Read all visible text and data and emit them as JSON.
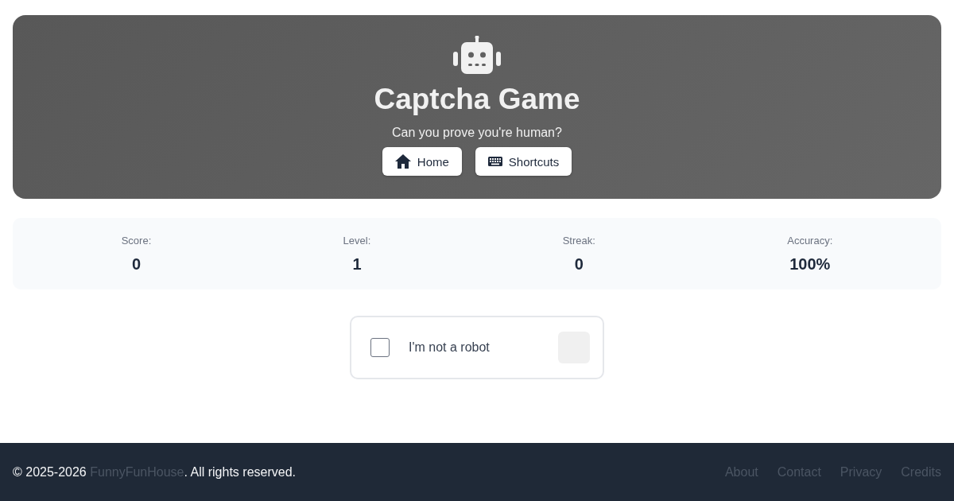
{
  "header": {
    "title": "Captcha Game",
    "subtitle": "Can you prove you're human?",
    "buttons": [
      {
        "kind": "home",
        "label": "Home"
      },
      {
        "kind": "keyboard",
        "label": "Shortcuts"
      }
    ]
  },
  "stats": [
    {
      "label": "Score:",
      "value": "0"
    },
    {
      "label": "Level:",
      "value": "1"
    },
    {
      "label": "Streak:",
      "value": "0"
    },
    {
      "label": "Accuracy:",
      "value": "100%"
    }
  ],
  "captcha": {
    "label": "I'm not a robot",
    "checked": false
  },
  "footer": {
    "copyright_prefix": "© 2025-2026 ",
    "brand_link": "FunnyFunHouse",
    "copyright_suffix": ". All rights reserved.",
    "links": [
      "About",
      "Contact",
      "Privacy",
      "Credits"
    ]
  }
}
